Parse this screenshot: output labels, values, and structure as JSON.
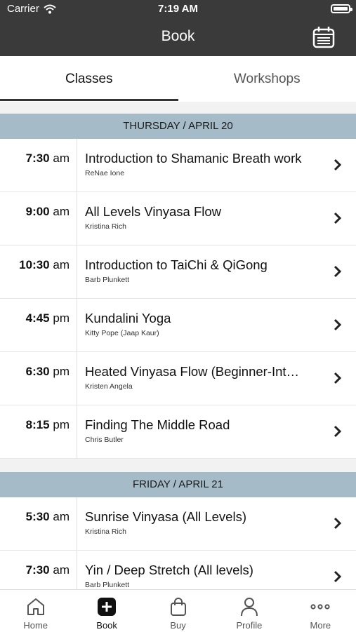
{
  "status_bar": {
    "carrier": "Carrier",
    "time": "7:19 AM"
  },
  "header": {
    "title": "Book"
  },
  "tabs": [
    {
      "label": "Classes",
      "active": true
    },
    {
      "label": "Workshops",
      "active": false
    }
  ],
  "days": [
    {
      "label": "THURSDAY / APRIL 20",
      "classes": [
        {
          "time": "7:30",
          "ampm": "am",
          "name": "Introduction to Shamanic Breath work",
          "instructor": "ReNae Ione"
        },
        {
          "time": "9:00",
          "ampm": "am",
          "name": "All Levels Vinyasa Flow",
          "instructor": "Kristina Rich"
        },
        {
          "time": "10:30",
          "ampm": "am",
          "name": "Introduction to TaiChi & QiGong",
          "instructor": "Barb Plunkett"
        },
        {
          "time": "4:45",
          "ampm": "pm",
          "name": "Kundalini Yoga",
          "instructor": "Kitty Pope (Jaap Kaur)"
        },
        {
          "time": "6:30",
          "ampm": "pm",
          "name": "Heated Vinyasa Flow (Beginner-Int…",
          "instructor": "Kristen Angela"
        },
        {
          "time": "8:15",
          "ampm": "pm",
          "name": "Finding The Middle Road",
          "instructor": "Chris Butler"
        }
      ]
    },
    {
      "label": "FRIDAY / APRIL 21",
      "classes": [
        {
          "time": "5:30",
          "ampm": "am",
          "name": "Sunrise Vinyasa (All Levels)",
          "instructor": "Kristina Rich"
        },
        {
          "time": "7:30",
          "ampm": "am",
          "name": "Yin / Deep Stretch (All levels)",
          "instructor": "Barb Plunkett"
        }
      ]
    }
  ],
  "tab_bar": [
    {
      "label": "Home",
      "icon": "home-icon"
    },
    {
      "label": "Book",
      "icon": "plus-square-icon",
      "active": true
    },
    {
      "label": "Buy",
      "icon": "shopping-bag-icon"
    },
    {
      "label": "Profile",
      "icon": "person-icon"
    },
    {
      "label": "More",
      "icon": "more-dots-icon"
    }
  ],
  "colors": {
    "header": "#3a3a3a",
    "day_header": "#a5bcc8",
    "background": "#f2f2f2"
  }
}
